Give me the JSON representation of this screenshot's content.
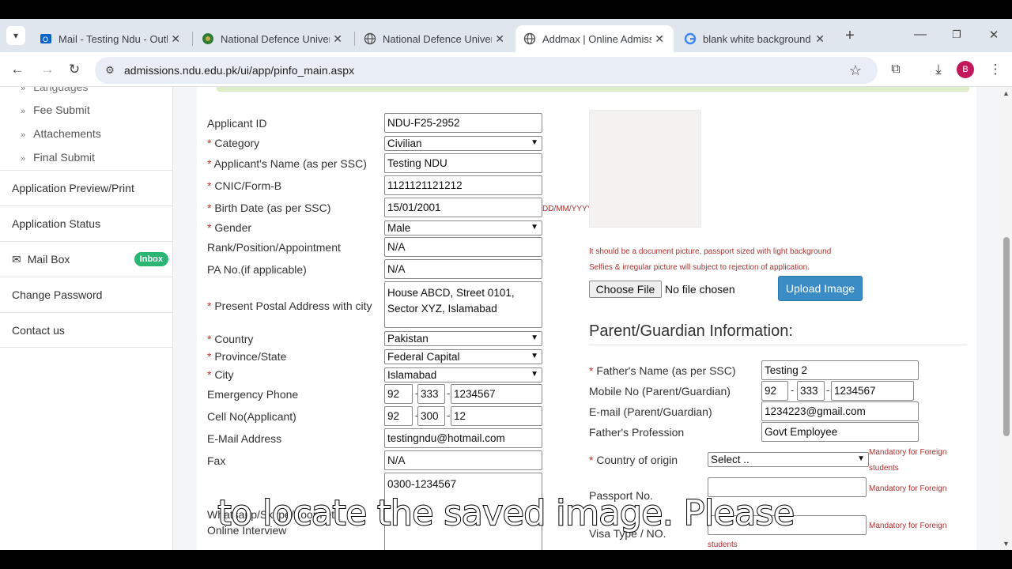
{
  "browser": {
    "tabs": [
      {
        "title": "Mail - Testing Ndu - Outl",
        "icon": "outlook-icon"
      },
      {
        "title": "National Defence Univers",
        "icon": "ndu-logo-icon"
      },
      {
        "title": "National Defence Univers",
        "icon": "globe-icon"
      },
      {
        "title": "Addmax | Online Admissi",
        "icon": "globe-icon"
      },
      {
        "title": "blank white background",
        "icon": "google-icon"
      }
    ],
    "url": "admissions.ndu.edu.pk/ui/app/pinfo_main.aspx",
    "profile_initial": "B"
  },
  "sidebar": {
    "sub_items": [
      "Languages",
      "Fee Submit",
      "Attachements",
      "Final Submit"
    ],
    "items": [
      {
        "label": "Application Preview/Print"
      },
      {
        "label": "Application Status"
      },
      {
        "label": "Mail Box",
        "badge": "Inbox"
      },
      {
        "label": "Change Password"
      },
      {
        "label": "Contact us"
      }
    ]
  },
  "form": {
    "applicant_id": {
      "label": "Applicant ID",
      "value": "NDU-F25-2952"
    },
    "category": {
      "label": "Category",
      "value": "Civilian"
    },
    "name": {
      "label": "Applicant's Name (as per SSC)",
      "value": "Testing NDU"
    },
    "cnic": {
      "label": "CNIC/Form-B",
      "value": "1121121121212"
    },
    "birth": {
      "label": "Birth Date (as per SSC)",
      "value": "15/01/2001",
      "hint": "DD/MM/YYYY"
    },
    "gender": {
      "label": "Gender",
      "value": "Male"
    },
    "rank": {
      "label": "Rank/Position/Appointment",
      "value": "N/A"
    },
    "pa_no": {
      "label": "PA No.(if applicable)",
      "value": "N/A"
    },
    "address": {
      "label": "Present Postal Address with city",
      "value": "House ABCD, Street 0101, Sector XYZ, Islamabad"
    },
    "country": {
      "label": "Country",
      "value": "Pakistan"
    },
    "province": {
      "label": "Province/State",
      "value": "Federal Capital"
    },
    "city": {
      "label": "City",
      "value": "Islamabad"
    },
    "emergency": {
      "label": "Emergency Phone",
      "code": "92",
      "prefix": "333",
      "number": "1234567"
    },
    "cell": {
      "label": "Cell No(Applicant)",
      "code": "92",
      "prefix": "300",
      "number": "12"
    },
    "email": {
      "label": "E-Mail Address",
      "value": "testingndu@hotmail.com"
    },
    "fax": {
      "label": "Fax",
      "value": "N/A"
    },
    "whatsapp": {
      "label_line1": "Whatsapp/Skype/Zoom etc",
      "label_line2": "Online Interview",
      "value": "0300-1234567"
    }
  },
  "photo": {
    "note1": "It should be a document picture, passport sized with light background",
    "note2": "Selfies & irregular picture will subject to rejection of application.",
    "choose_file": "Choose File",
    "no_file": "No file chosen",
    "upload": "Upload Image"
  },
  "guardian": {
    "heading": "Parent/Guardian Information:",
    "father_name": {
      "label": "Father's Name (as per SSC)",
      "value": "Testing 2"
    },
    "mobile": {
      "label": "Mobile No (Parent/Guardian)",
      "code": "92",
      "prefix": "333",
      "number": "1234567"
    },
    "email": {
      "label": "E-mail (Parent/Guardian)",
      "value": "1234223@gmail.com"
    },
    "profession": {
      "label": "Father's Profession",
      "value": "Govt Employee"
    },
    "country_origin": {
      "label": "Country of origin",
      "value": "Select .."
    },
    "passport": {
      "label": "Passport No.",
      "value": ""
    },
    "visa": {
      "label": "Visa Type / NO.",
      "value": ""
    },
    "mandatory_note": "Mandatory for Foreign students",
    "mandatory_short": "Mandatory for Foreign"
  },
  "caption": "to locate the saved image. Please",
  "colors": {
    "accent_button": "#3b8cc4",
    "required": "#c9302c",
    "badge": "#2bb673"
  }
}
